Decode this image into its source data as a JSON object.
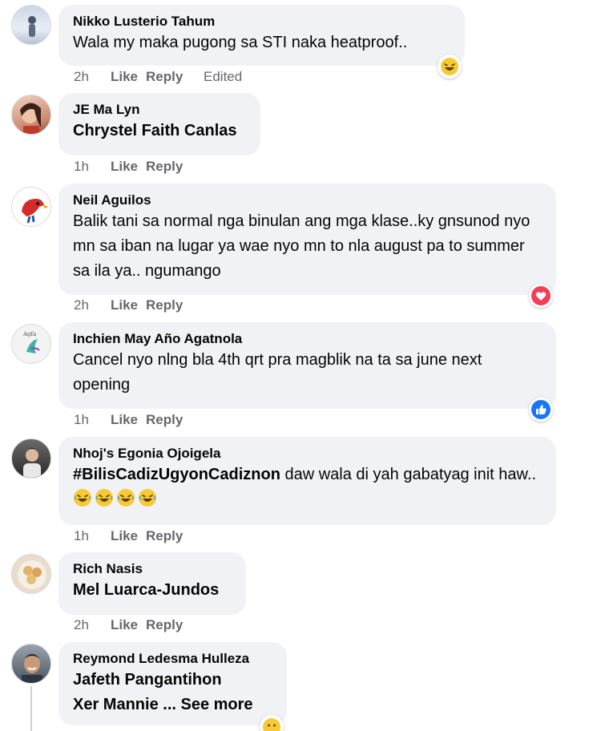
{
  "comments": [
    {
      "author": "Nikko Lusterio Tahum",
      "text": "Wala my maka pugong sa STI naka heatproof..",
      "time": "2h",
      "like": "Like",
      "reply": "Reply",
      "edited": "Edited",
      "reaction_icon": "haha-emoji-icon",
      "avatar_icon": "person-standing-photo-icon"
    },
    {
      "author": "JE Ma Lyn",
      "text": "Chrystel Faith Canlas",
      "time": "1h",
      "like": "Like",
      "reply": "Reply",
      "avatar_icon": "woman-selfie-photo-icon"
    },
    {
      "author": "Neil Aguilos",
      "text": "Balik tani sa normal nga binulan ang mga klase..ky gnsunod nyo mn sa iban na lugar ya wae nyo mn to nla august pa to summer sa ila ya.. ngumango",
      "time": "2h",
      "like": "Like",
      "reply": "Reply",
      "reaction_icon": "love-heart-reaction-icon",
      "avatar_icon": "red-bird-logo-icon"
    },
    {
      "author": "Inchien May Año Agatnola",
      "text": "Cancel nyo nlng bla 4th qrt pra magblik na ta sa june next opening",
      "time": "1h",
      "like": "Like",
      "reply": "Reply",
      "reaction_icon": "like-thumb-reaction-icon",
      "avatar_icon": "bird-logo-avatar-icon"
    },
    {
      "author": "Nhoj's Egonia Ojoigela",
      "hashtag": "#BilisCadizUgyonCadiznon",
      "text": " daw wala di yah gabatyag init haw.. ",
      "emoji_count": "4",
      "time": "1h",
      "like": "Like",
      "reply": "Reply",
      "avatar_icon": "person-photo-icon"
    },
    {
      "author": "Rich Nasis",
      "text": "Mel Luarca-Jundos",
      "time": "2h",
      "like": "Like",
      "reply": "Reply",
      "avatar_icon": "food-photo-avatar-icon"
    },
    {
      "author": "Reymond Ledesma Hulleza",
      "text_line1": "Jafeth Pangantihon",
      "text_line2": "Xer Mannie ... See more",
      "avatar_icon": "man-smiling-photo-icon"
    }
  ]
}
